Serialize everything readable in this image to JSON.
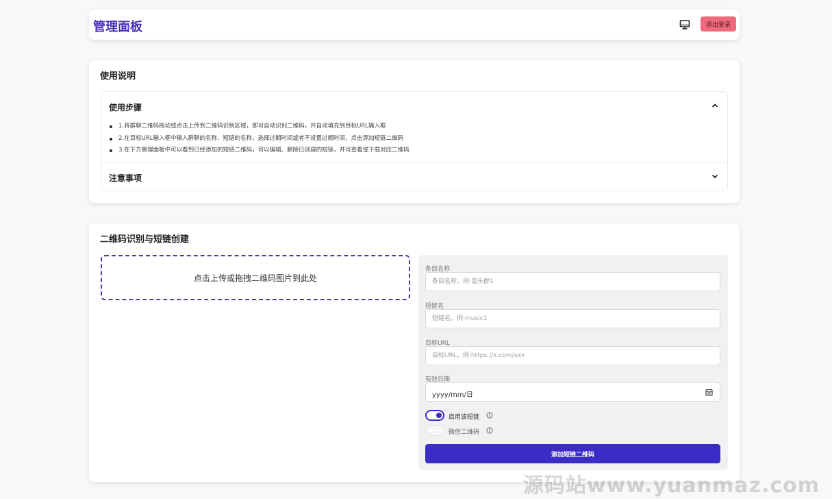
{
  "header": {
    "title": "管理面板",
    "logout_label": "退出登录"
  },
  "instructions": {
    "title": "使用说明",
    "steps": {
      "label": "使用步骤",
      "items": [
        "1.将群聊二维码拖动或点击上传到二维码识别区域，即可自动识别二维码，并自动填充到目标URL输入框",
        "2.在目标URL输入框中输入群聊的名称、短链的名称，选择过期时间或者不设置过期时间，点击添加短链二维码",
        "3.在下方管理面板中可以看到已经添加的短链二维码，可以编辑、删除已创建的短链，并可查看或下载对应二维码"
      ]
    },
    "notes": {
      "label": "注意事项"
    }
  },
  "create": {
    "title": "二维码识别与短链创建",
    "dropzone_text": "点击上传或拖拽二维码图片到此处",
    "fields": {
      "name_label": "条目名称",
      "name_placeholder": "条目名称，例:音乐群1",
      "short_label": "短链名",
      "short_placeholder": "短链名，例:music1",
      "url_label": "目标URL",
      "url_placeholder": "目标URL，例:https://x.com/xxx",
      "date_label": "有效日期",
      "date_value": "yyyy/mm/日"
    },
    "toggles": {
      "enable_label": "启用该短链",
      "enable_on": true,
      "wechat_label": "微信二维码",
      "wechat_on": false
    },
    "submit_label": "添加短链二维码"
  },
  "watermark": "源码站www.yuanmaz.com",
  "colors": {
    "accent": "#3a2cc4",
    "title": "#4a2fbd",
    "logout": "#ee6b7a"
  }
}
